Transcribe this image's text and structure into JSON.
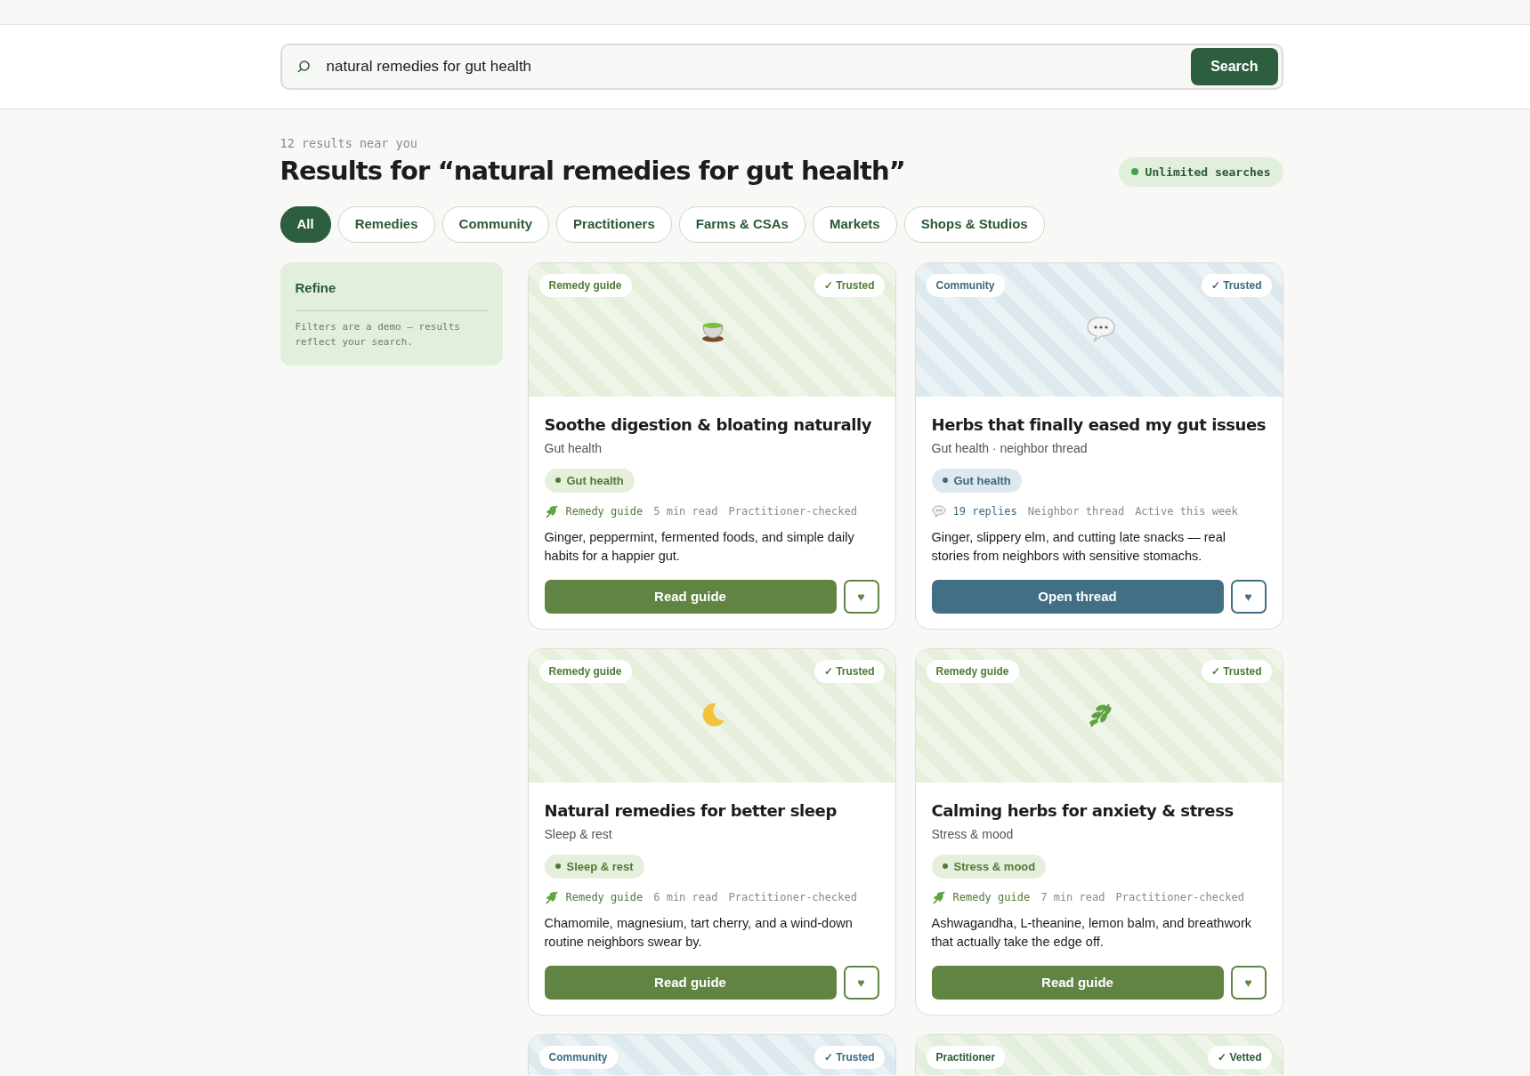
{
  "search": {
    "value": "natural remedies for gut health",
    "button": "Search"
  },
  "results_count": "12 results near you",
  "heading": "Results for “natural remedies for gut health”",
  "plan_badge": "Unlimited searches",
  "filters": [
    {
      "label": "All",
      "selected": true
    },
    {
      "label": "Remedies",
      "selected": false
    },
    {
      "label": "Community",
      "selected": false
    },
    {
      "label": "Practitioners",
      "selected": false
    },
    {
      "label": "Farms & CSAs",
      "selected": false
    },
    {
      "label": "Markets",
      "selected": false
    },
    {
      "label": "Shops & Studios",
      "selected": false
    }
  ],
  "sidebar": {
    "title": "Refine",
    "note": "Filters are a demo — results reflect your search."
  },
  "cards": [
    {
      "kind": "guide",
      "type_tag": "Remedy guide",
      "trust": "✓ Trusted",
      "title": "Soothe digestion & bloating naturally",
      "subtitle": "Gut health",
      "topic": "Gut health",
      "meta": [
        "Remedy guide",
        "5 min read",
        "Practitioner-checked"
      ],
      "summary": "Ginger, peppermint, fermented foods, and simple daily habits for a happier gut.",
      "action": "Read guide",
      "save": "♥"
    },
    {
      "kind": "community",
      "type_tag": "Community",
      "trust": "✓ Trusted",
      "title": "Herbs that finally eased my gut issues",
      "subtitle": "Gut health · neighbor thread",
      "topic": "Gut health",
      "meta": [
        "19 replies",
        "Neighbor thread",
        "Active this week"
      ],
      "summary": "Ginger, slippery elm, and cutting late snacks — real stories from neighbors with sensitive stomachs.",
      "action": "Open thread",
      "save": "♥"
    },
    {
      "kind": "guide",
      "type_tag": "Remedy guide",
      "trust": "✓ Trusted",
      "title": "Natural remedies for better sleep",
      "subtitle": "Sleep & rest",
      "topic": "Sleep & rest",
      "meta": [
        "Remedy guide",
        "6 min read",
        "Practitioner-checked"
      ],
      "summary": "Chamomile, magnesium, tart cherry, and a wind-down routine neighbors swear by.",
      "action": "Read guide",
      "save": "♥"
    },
    {
      "kind": "guide",
      "type_tag": "Remedy guide",
      "trust": "✓ Trusted",
      "title": "Calming herbs for anxiety & stress",
      "subtitle": "Stress & mood",
      "topic": "Stress & mood",
      "meta": [
        "Remedy guide",
        "7 min read",
        "Practitioner-checked"
      ],
      "summary": "Ashwagandha, L-theanine, lemon balm, and breathwork that actually take the edge off.",
      "action": "Read guide",
      "save": "♥"
    },
    {
      "kind": "community",
      "type_tag": "Community",
      "trust": "✓ Trusted"
    },
    {
      "kind": "practitioner",
      "type_tag": "Practitioner",
      "trust": "✓ Vetted"
    }
  ]
}
